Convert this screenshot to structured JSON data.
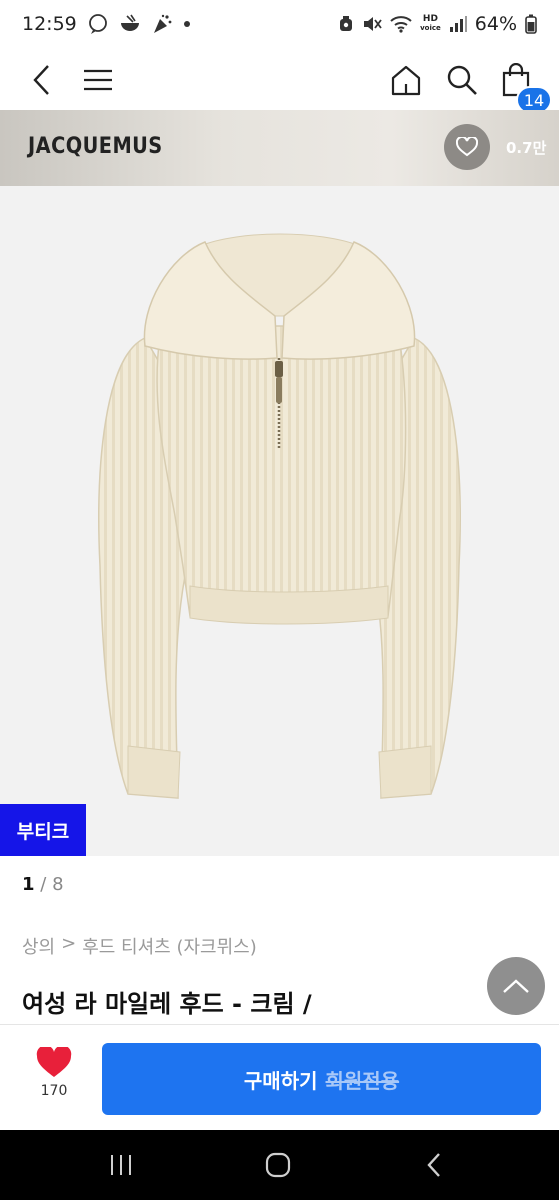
{
  "status_bar": {
    "time": "12:59",
    "hd_label": "HD",
    "voice_label": "voice",
    "battery": "64%"
  },
  "header": {
    "cart_count": "14",
    "icons": [
      "back-icon",
      "menu-icon",
      "home-icon",
      "search-icon",
      "shopping-bag-icon"
    ]
  },
  "brand": {
    "name": "JACQUEMUS",
    "favorites": "0.7만"
  },
  "product": {
    "image_alt": "cream knit half-zip sweater",
    "badge": "부티크",
    "page_current": "1",
    "page_separator": "/",
    "page_total": "8",
    "breadcrumb": [
      "상의",
      ">",
      "후드 티셔츠 (자크뮈스)"
    ],
    "title": "여성 라 마일레 후드 - 크림 /"
  },
  "actions": {
    "like_count": "170",
    "buy_label": "구매하기",
    "members_only": "회원전용"
  },
  "colors": {
    "accent": "#1e74f0",
    "badge_blue": "#1515e8",
    "heart": "#e8203a"
  }
}
